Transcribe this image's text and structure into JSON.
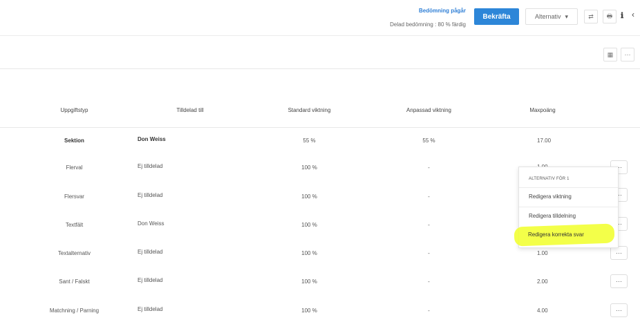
{
  "header": {
    "status_title": "Bedömning pågår",
    "status_sub": "Delad bedömning : 80 % färdig",
    "confirm_label": "Bekräfta",
    "options_label": "Alternativ",
    "options_caret": "▾",
    "swap_icon": "⇄",
    "print_icon": "🖶",
    "info_icon": "ℹ",
    "chevron_left_icon": "‹"
  },
  "toolbar": {
    "calendar_icon": "▦",
    "more_icon": "···"
  },
  "table": {
    "headers": {
      "type": "Uppgiftstyp",
      "assigned": "Tilldelad till",
      "std_weight": "Standard viktning",
      "custom_weight": "Anpassad viktning",
      "max_points": "Maxpoäng"
    },
    "rows": [
      {
        "type": "Sektion",
        "assigned": "Don Weiss",
        "std": "55 %",
        "custom": "55 %",
        "max": "17.00"
      },
      {
        "type": "Flerval",
        "assigned": "Ej tilldelad",
        "std": "100 %",
        "custom": "-",
        "max": "1.00"
      },
      {
        "type": "Flersvar",
        "assigned": "Ej tilldelad",
        "std": "100 %",
        "custom": "-",
        "max": ""
      },
      {
        "type": "Textfält",
        "assigned": "Don Weiss",
        "std": "100 %",
        "custom": "-",
        "max": ""
      },
      {
        "type": "Textalternativ",
        "assigned": "Ej tilldelad",
        "std": "100 %",
        "custom": "-",
        "max": "1.00"
      },
      {
        "type": "Sant / Falskt",
        "assigned": "Ej tilldelad",
        "std": "100 %",
        "custom": "-",
        "max": "2.00"
      },
      {
        "type": "Matchning / Parning",
        "assigned": "Ej tilldelad",
        "std": "100 %",
        "custom": "-",
        "max": "4.00"
      }
    ],
    "row_more_icon": "···"
  },
  "menu": {
    "heading": "ALTERNATIV FÖR 1",
    "items": [
      "Redigera viktning",
      "Redigera tilldelning",
      "Redigera korrekta svar"
    ],
    "highlight_color": "#f2ff3a"
  },
  "colors": {
    "accent": "#2d86d8"
  }
}
